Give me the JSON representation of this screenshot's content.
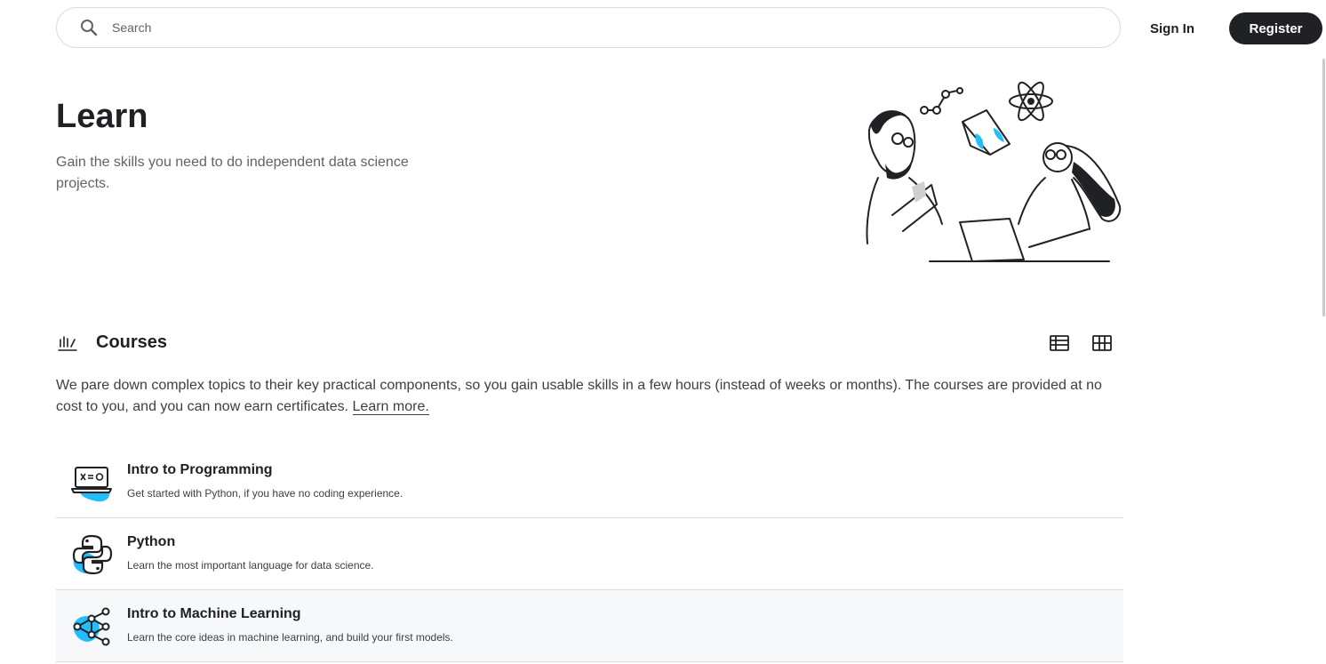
{
  "header": {
    "search_placeholder": "Search",
    "signin_label": "Sign In",
    "register_label": "Register"
  },
  "hero": {
    "title": "Learn",
    "subtitle": "Gain the skills you need to do independent data science projects."
  },
  "courses": {
    "heading": "Courses",
    "description": "We pare down complex topics to their key practical components, so you gain usable skills in a few hours (instead of weeks or months). The courses are provided at no cost to you, and you can now earn certificates.",
    "learn_more": "Learn more.",
    "items": [
      {
        "name": "Intro to Programming",
        "desc": "Get started with Python, if you have no coding experience.",
        "icon": "laptop-code-icon"
      },
      {
        "name": "Python",
        "desc": "Learn the most important language for data science.",
        "icon": "python-icon"
      },
      {
        "name": "Intro to Machine Learning",
        "desc": "Learn the core ideas in machine learning, and build your first models.",
        "icon": "neural-network-icon"
      }
    ]
  },
  "colors": {
    "accent_blue": "#20beff",
    "dark": "#202124",
    "border": "#dadce0"
  }
}
